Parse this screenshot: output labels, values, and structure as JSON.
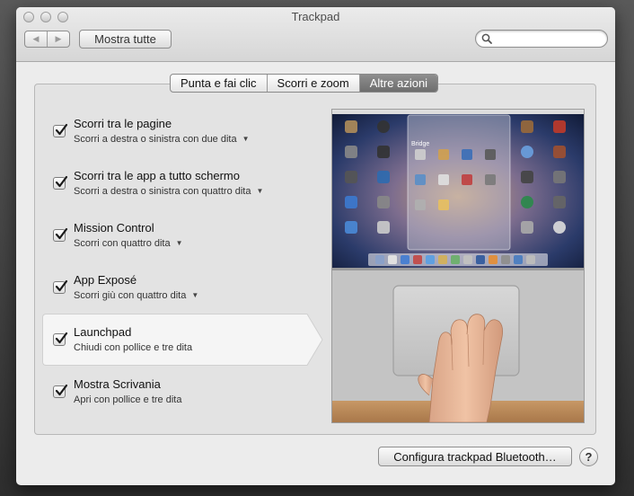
{
  "window": {
    "title": "Trackpad"
  },
  "toolbar": {
    "back_icon": "back-icon",
    "forward_icon": "forward-icon",
    "show_all_label": "Mostra tutte",
    "search_value": "",
    "search_placeholder": ""
  },
  "tabs": [
    {
      "label": "Punta e fai clic",
      "active": false
    },
    {
      "label": "Scorri e zoom",
      "active": false
    },
    {
      "label": "Altre azioni",
      "active": true
    }
  ],
  "gestures": [
    {
      "title": "Scorri tra le pagine",
      "subtitle": "Scorri a destra o sinistra con due dita",
      "checked": true,
      "has_dropdown": true,
      "selected": false
    },
    {
      "title": "Scorri tra le app a tutto schermo",
      "subtitle": "Scorri a destra o sinistra con quattro dita",
      "checked": true,
      "has_dropdown": true,
      "selected": false
    },
    {
      "title": "Mission Control",
      "subtitle": "Scorri con quattro dita",
      "checked": true,
      "has_dropdown": true,
      "selected": false
    },
    {
      "title": "App Exposé",
      "subtitle": "Scorri giù con quattro dita",
      "checked": true,
      "has_dropdown": true,
      "selected": false
    },
    {
      "title": "Launchpad",
      "subtitle": "Chiudi con pollice e tre dita",
      "checked": true,
      "has_dropdown": false,
      "selected": true
    },
    {
      "title": "Mostra Scrivania",
      "subtitle": "Apri con pollice e tre dita",
      "checked": true,
      "has_dropdown": false,
      "selected": false
    }
  ],
  "preview": {
    "folder_label": "Bridge"
  },
  "footer": {
    "configure_label": "Configura trackpad Bluetooth…",
    "help_label": "?"
  },
  "colors": {
    "active_tab": "#7a7a7a",
    "panel_bg": "#e3e3e3",
    "window_bg": "#ececec"
  }
}
